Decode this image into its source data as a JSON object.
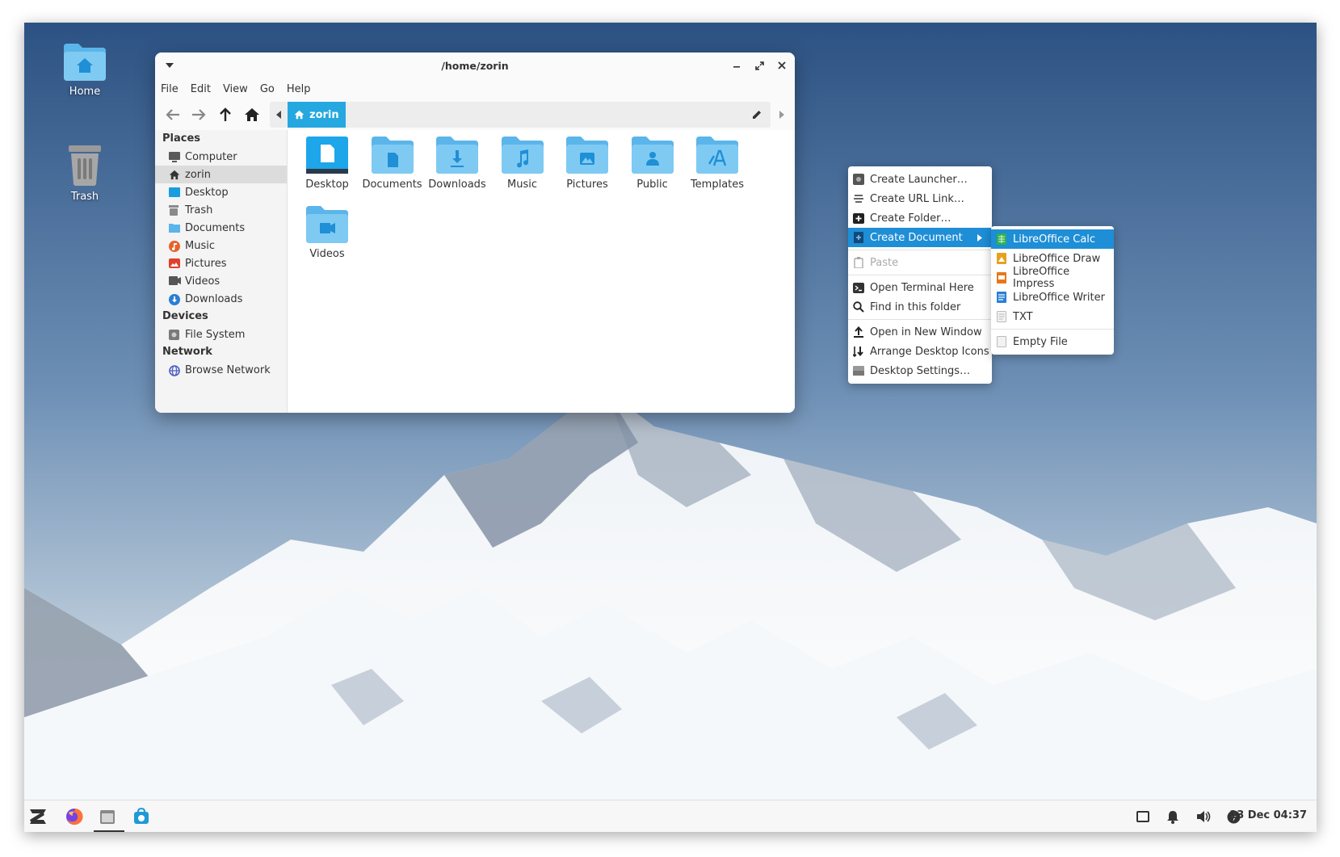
{
  "desktop": {
    "icons": [
      {
        "label": "Home",
        "icon": "home-folder-icon"
      },
      {
        "label": "Trash",
        "icon": "trash-icon"
      }
    ]
  },
  "window": {
    "title": "/home/zorin",
    "menubar": [
      "File",
      "Edit",
      "View",
      "Go",
      "Help"
    ],
    "breadcrumb": "zorin",
    "sidebar": {
      "places_heading": "Places",
      "places": [
        {
          "label": "Computer",
          "icon": "computer-icon",
          "color": "#5a5a5a"
        },
        {
          "label": "zorin",
          "icon": "home-icon",
          "color": "#333333"
        },
        {
          "label": "Desktop",
          "icon": "desktop-icon",
          "color": "#1a9ee0"
        },
        {
          "label": "Trash",
          "icon": "trash-icon",
          "color": "#8a8a8a"
        },
        {
          "label": "Documents",
          "icon": "documents-icon",
          "color": "#5ab5ea"
        },
        {
          "label": "Music",
          "icon": "music-icon",
          "color": "#e8632a"
        },
        {
          "label": "Pictures",
          "icon": "pictures-icon",
          "color": "#e0402e"
        },
        {
          "label": "Videos",
          "icon": "videos-icon",
          "color": "#555555"
        },
        {
          "label": "Downloads",
          "icon": "downloads-icon",
          "color": "#2a7fd4"
        }
      ],
      "devices_heading": "Devices",
      "devices": [
        {
          "label": "File System",
          "icon": "drive-icon",
          "color": "#7a7a7a"
        }
      ],
      "network_heading": "Network",
      "network": [
        {
          "label": "Browse Network",
          "icon": "network-icon",
          "color": "#4a5fc1"
        }
      ]
    },
    "files": [
      {
        "label": "Desktop",
        "icon": "desktop-folder-icon"
      },
      {
        "label": "Documents",
        "icon": "documents-folder-icon"
      },
      {
        "label": "Downloads",
        "icon": "downloads-folder-icon"
      },
      {
        "label": "Music",
        "icon": "music-folder-icon"
      },
      {
        "label": "Pictures",
        "icon": "pictures-folder-icon"
      },
      {
        "label": "Public",
        "icon": "public-folder-icon"
      },
      {
        "label": "Templates",
        "icon": "templates-folder-icon"
      },
      {
        "label": "Videos",
        "icon": "videos-folder-icon"
      }
    ]
  },
  "context_menu": {
    "items": [
      {
        "label": "Create Launcher…",
        "icon": "launcher-icon"
      },
      {
        "label": "Create URL Link…",
        "icon": "link-icon"
      },
      {
        "label": "Create Folder…",
        "icon": "new-folder-icon"
      },
      {
        "label": "Create Document",
        "icon": "new-document-icon",
        "highlighted": true,
        "submenu": true
      },
      {
        "label": "Paste",
        "icon": "paste-icon",
        "disabled": true
      },
      {
        "label": "Open Terminal Here",
        "icon": "terminal-icon"
      },
      {
        "label": "Find in this folder",
        "icon": "search-icon"
      },
      {
        "label": "Open in New Window",
        "icon": "upload-icon"
      },
      {
        "label": "Arrange Desktop Icons",
        "icon": "arrange-icon"
      },
      {
        "label": "Desktop Settings…",
        "icon": "settings-icon"
      }
    ]
  },
  "submenu": {
    "items": [
      {
        "label": "LibreOffice Calc",
        "icon": "calc-icon",
        "highlighted": true
      },
      {
        "label": "LibreOffice Draw",
        "icon": "draw-icon"
      },
      {
        "label": "LibreOffice Impress",
        "icon": "impress-icon"
      },
      {
        "label": "LibreOffice Writer",
        "icon": "writer-icon"
      },
      {
        "label": "TXT",
        "icon": "text-file-icon"
      },
      {
        "label": "Empty File",
        "icon": "empty-file-icon"
      }
    ]
  },
  "taskbar": {
    "apps": [
      {
        "name": "Zorin menu",
        "icon": "zorin-logo-icon"
      },
      {
        "name": "Firefox",
        "icon": "firefox-icon"
      },
      {
        "name": "Files",
        "icon": "files-icon",
        "active": true
      },
      {
        "name": "Software",
        "icon": "software-store-icon"
      }
    ],
    "tray": [
      "workspace-icon",
      "bell-icon",
      "volume-icon",
      "power-icon"
    ],
    "clock": "13 Dec 04:37"
  },
  "colors": {
    "accent": "#1e8ed6",
    "folder": "#5ab5ea",
    "breadcrumb": "#25a8e0"
  }
}
